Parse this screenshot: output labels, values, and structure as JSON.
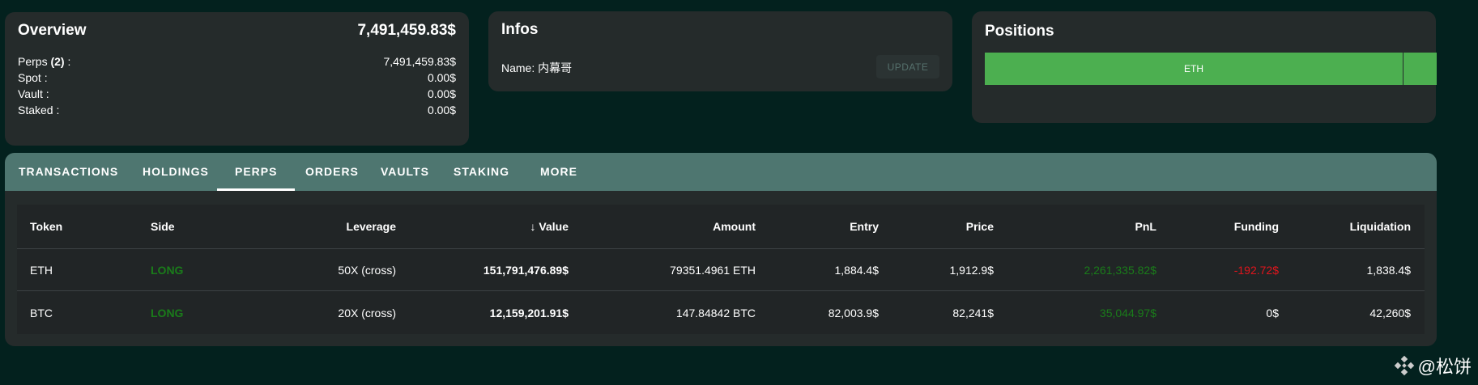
{
  "overview": {
    "title": "Overview",
    "total": "7,491,459.83$",
    "rows": [
      {
        "label": "Perps",
        "count": "(2)",
        "value": "7,491,459.83$"
      },
      {
        "label": "Spot :",
        "value": "0.00$"
      },
      {
        "label": "Vault :",
        "value": "0.00$"
      },
      {
        "label": "Staked :",
        "value": "0.00$"
      }
    ]
  },
  "infos": {
    "title": "Infos",
    "name": "Name: 内幕哥",
    "update": "UPDATE"
  },
  "positions": {
    "title": "Positions",
    "bars": [
      {
        "label": "ETH",
        "share": 0.926
      },
      {
        "label": "",
        "share": 0.074
      }
    ],
    "color": "#4caf50"
  },
  "tabs": [
    "TRANSACTIONS",
    "HOLDINGS",
    "PERPS",
    "ORDERS",
    "VAULTS",
    "STAKING",
    "MORE"
  ],
  "active_tab": "PERPS",
  "table": {
    "headers": [
      "Token",
      "Side",
      "Leverage",
      "Value",
      "Amount",
      "Entry",
      "Price",
      "PnL",
      "Funding",
      "Liquidation"
    ],
    "rows": [
      [
        "ETH",
        "LONG",
        "50X (cross)",
        "151,791,476.89$",
        "79351.4961 ETH",
        "1,884.4$",
        "1,912.9$",
        "2,261,335.82$",
        "-192.72$",
        "1,838.4$"
      ],
      [
        "BTC",
        "LONG",
        "20X (cross)",
        "12,159,201.91$",
        "147.84842 BTC",
        "82,003.9$",
        "82,241$",
        "35,044.97$",
        "0$",
        "42,260$"
      ]
    ]
  },
  "watermark": "@松饼"
}
